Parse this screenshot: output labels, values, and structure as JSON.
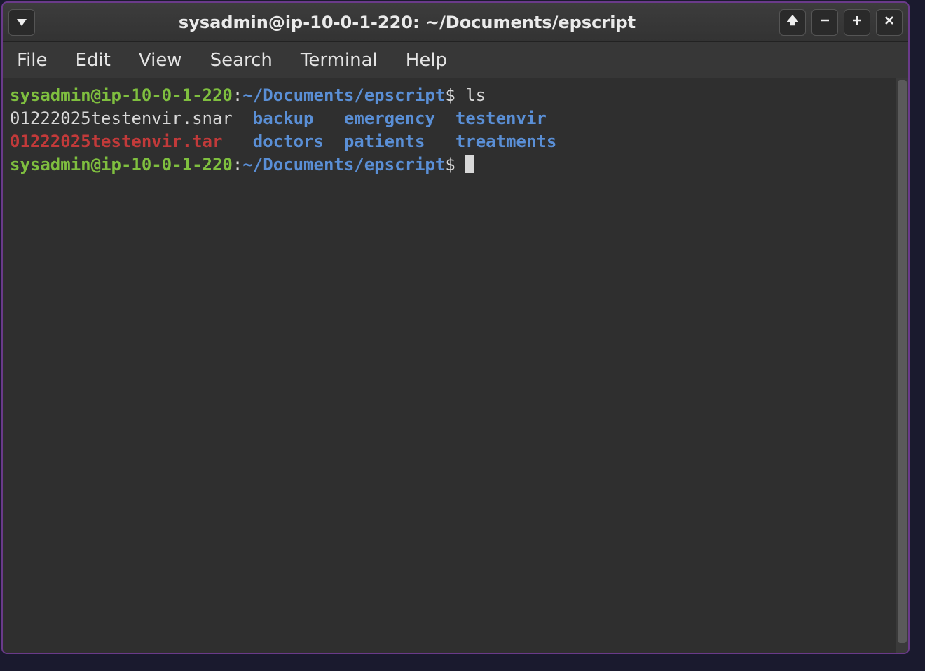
{
  "window": {
    "title": "sysadmin@ip-10-0-1-220: ~/Documents/epscript"
  },
  "menubar": {
    "items": [
      "File",
      "Edit",
      "View",
      "Search",
      "Terminal",
      "Help"
    ]
  },
  "terminal": {
    "prompt1": {
      "userhost": "sysadmin@ip-10-0-1-220",
      "sep1": ":",
      "path": "~/Documents/epscript",
      "sigil": "$ ",
      "command": "ls"
    },
    "ls_row1": {
      "c0": "01222025testenvir.snar",
      "c1": "backup",
      "c2": "emergency",
      "c3": "testenvir"
    },
    "ls_row2": {
      "c0": "01222025testenvir.tar",
      "c1": "doctors",
      "c2": "patients",
      "c3": "treatments"
    },
    "prompt2": {
      "userhost": "sysadmin@ip-10-0-1-220",
      "sep1": ":",
      "path": "~/Documents/epscript",
      "sigil": "$ "
    }
  }
}
